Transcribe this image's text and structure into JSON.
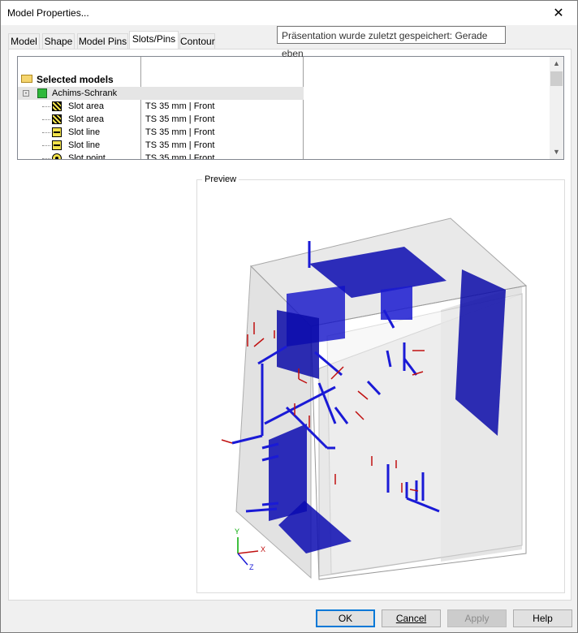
{
  "window": {
    "title": "Model Properties...",
    "close_glyph": "✕"
  },
  "tooltip": {
    "text": "Präsentation wurde zuletzt gespeichert: Gerade eben"
  },
  "tabs": [
    {
      "label": "Model"
    },
    {
      "label": "Shape"
    },
    {
      "label": "Model Pins"
    },
    {
      "label": "Slots/Pins",
      "active": true
    },
    {
      "label": "Contour"
    }
  ],
  "tree": {
    "root_label": "Selected models",
    "model_label": "Achims-Schrank",
    "rows": [
      {
        "name": "Slot area",
        "value": "TS 35 mm | Front",
        "icon": "slot-area-icon"
      },
      {
        "name": "Slot area",
        "value": "TS 35 mm | Front",
        "icon": "slot-area-icon"
      },
      {
        "name": "Slot line",
        "value": "TS 35 mm | Front",
        "icon": "slot-line-icon"
      },
      {
        "name": "Slot line",
        "value": "TS 35 mm | Front",
        "icon": "slot-line-icon"
      },
      {
        "name": "Slot point",
        "value": "TS 35 mm | Front",
        "icon": "slot-point-icon"
      }
    ]
  },
  "preview": {
    "label": "Preview",
    "axes": {
      "x": "X",
      "y": "Y",
      "z": "Z"
    }
  },
  "buttons": {
    "ok": "OK",
    "cancel": "Cancel",
    "apply": "Apply",
    "help": "Help"
  }
}
